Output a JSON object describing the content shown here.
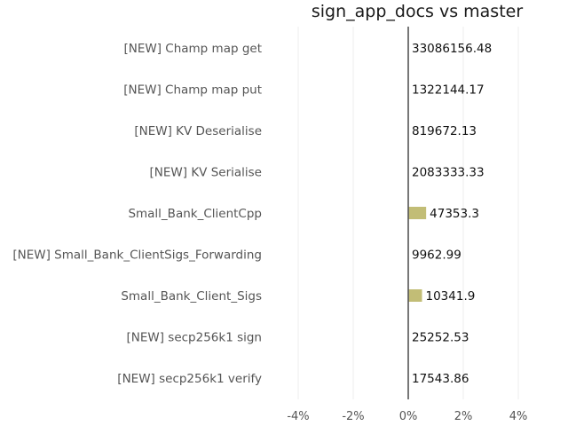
{
  "chart_data": {
    "type": "bar",
    "orientation": "horizontal",
    "title": "sign_app_docs vs master",
    "categories": [
      "[NEW] Champ map get",
      "[NEW] Champ map put",
      "[NEW] KV Deserialise",
      "[NEW] KV Serialise",
      "Small_Bank_ClientCpp",
      "[NEW] Small_Bank_ClientSigs_Forwarding",
      "Small_Bank_Client_Sigs",
      "[NEW] secp256k1 sign",
      "[NEW] secp256k1 verify"
    ],
    "values": [
      0,
      0,
      0,
      0,
      0.65,
      0,
      0.5,
      0,
      0
    ],
    "value_labels": [
      "33086156.48",
      "1322144.17",
      "819672.13",
      "2083333.33",
      "47353.3",
      "9962.99",
      "10341.9",
      "25252.53",
      "17543.86"
    ],
    "xlim": [
      -5,
      5
    ],
    "xticks": [
      -4,
      -2,
      0,
      2,
      4
    ],
    "xtick_labels": [
      "-4%",
      "-2%",
      "0%",
      "2%",
      "4%"
    ],
    "grid": "vertical",
    "bar_color": "#c2bd76",
    "zero_line_color": "#555555"
  }
}
